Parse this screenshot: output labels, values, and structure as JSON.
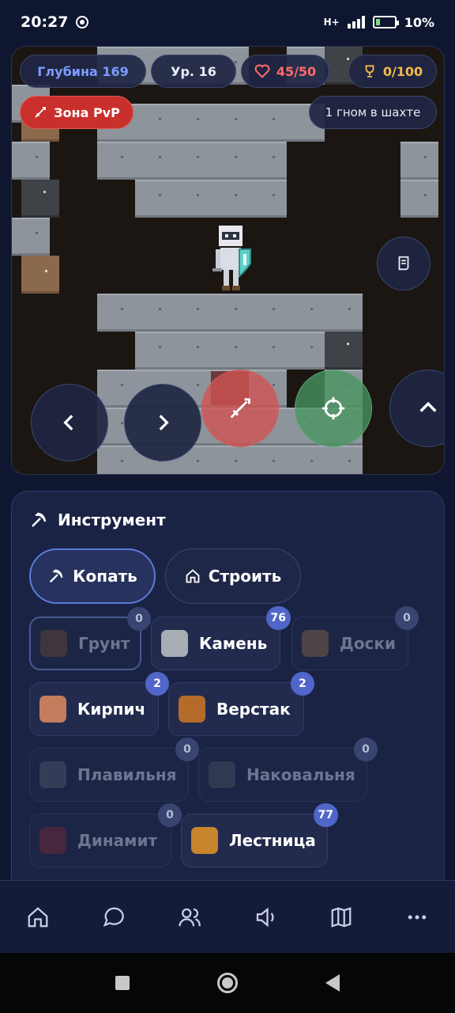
{
  "status_bar": {
    "time": "20:27",
    "battery": "10%",
    "network": "H+"
  },
  "hud": {
    "depth": "Глубина 169",
    "level": "Ур. 16",
    "health": "45/50",
    "trophy": "0/100",
    "pvp": "Зона PvP",
    "players": "1 гном в шахте"
  },
  "colors": {
    "depth": "#7c9cff",
    "health": "#ff6b6b",
    "trophy": "#f5b94a",
    "pvp": "#c9302c",
    "accent": "#5066c8"
  },
  "controls": {
    "left": "chevron-left-icon",
    "right": "chevron-right-icon",
    "attack": "sword-icon",
    "aim": "crosshair-icon",
    "up": "chevron-up-icon",
    "scroll": "scroll-icon"
  },
  "panel": {
    "title": "Инструмент",
    "modes": [
      {
        "label": "Копать",
        "icon": "pickaxe-icon",
        "active": true
      },
      {
        "label": "Строить",
        "icon": "home-icon",
        "active": false
      }
    ],
    "materials": [
      {
        "label": "Грунт",
        "count": "0",
        "color": "#6b4a32"
      },
      {
        "label": "Камень",
        "count": "76",
        "color": "#a7adb3"
      },
      {
        "label": "Доски",
        "count": "0",
        "color": "#8a6a47"
      },
      {
        "label": "Кирпич",
        "count": "2",
        "color": "#c47c5d"
      },
      {
        "label": "Верстак",
        "count": "2",
        "color": "#b56c2b"
      },
      {
        "label": "Плавильня",
        "count": "0",
        "color": "#525a6c"
      },
      {
        "label": "Наковальня",
        "count": "0",
        "color": "#4a5062"
      },
      {
        "label": "Динамит",
        "count": "0",
        "color": "#7a2b34"
      },
      {
        "label": "Лестница",
        "count": "77",
        "color": "#c9852d"
      }
    ]
  },
  "bottom_nav": [
    "home-icon",
    "chat-icon",
    "users-icon",
    "sound-icon",
    "map-icon",
    "more-icon"
  ]
}
